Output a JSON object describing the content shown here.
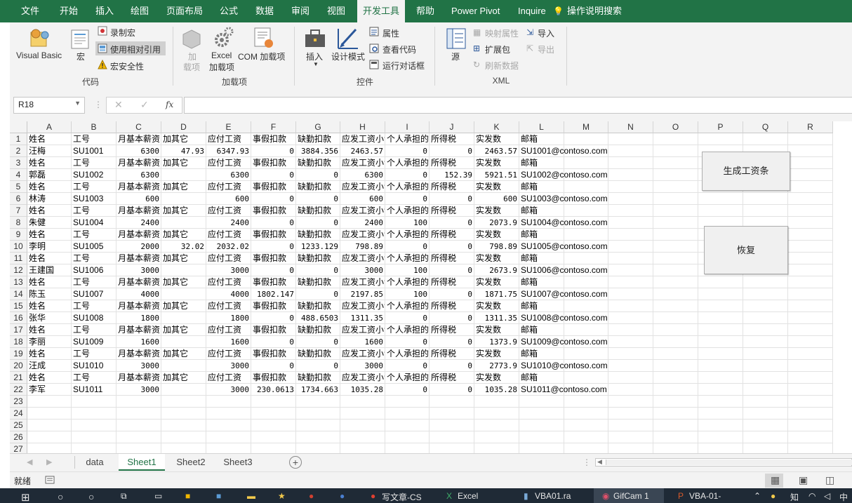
{
  "menu": {
    "tabs": [
      "文件",
      "开始",
      "插入",
      "绘图",
      "页面布局",
      "公式",
      "数据",
      "审阅",
      "视图",
      "开发工具",
      "帮助",
      "Power Pivot",
      "Inquire",
      "操作说明搜索"
    ],
    "active": "开发工具"
  },
  "ribbon": {
    "code": {
      "visual_basic": "Visual Basic",
      "macros": "宏",
      "record_macro": "录制宏",
      "relative_ref": "使用相对引用",
      "macro_security": "宏安全性",
      "group": "代码"
    },
    "addins": {
      "addins_line1": "加",
      "addins_line2": "载项",
      "excel_addins_line1": "Excel",
      "excel_addins_line2": "加载项",
      "com_addins": "COM 加载项",
      "group": "加载项"
    },
    "controls": {
      "insert": "插入",
      "design_mode": "设计模式",
      "properties": "属性",
      "view_code": "查看代码",
      "run_dialog": "运行对话框",
      "group": "控件"
    },
    "xml": {
      "source": "源",
      "map_props": "映射属性",
      "expansion": "扩展包",
      "refresh": "刷新数据",
      "import": "导入",
      "export": "导出",
      "group": "XML"
    }
  },
  "formula_bar": {
    "name_box": "R18",
    "fx": "fx",
    "formula": ""
  },
  "columns": [
    "A",
    "B",
    "C",
    "D",
    "E",
    "F",
    "G",
    "H",
    "I",
    "J",
    "K",
    "L",
    "M",
    "N",
    "O",
    "P",
    "Q",
    "R"
  ],
  "rows": [
    [
      "姓名",
      "工号",
      "月基本薪资",
      "加其它",
      "应付工资",
      "事假扣款",
      "缺勤扣款",
      "应发工资小计",
      "个人承担的",
      "所得税",
      "实发数",
      "邮箱"
    ],
    [
      "汪梅",
      "SU1001",
      "6300",
      "47.93",
      "6347.93",
      "0",
      "3884.356",
      "2463.57",
      "0",
      "0",
      "2463.57",
      "SU1001@contoso.com"
    ],
    [
      "姓名",
      "工号",
      "月基本薪资",
      "加其它",
      "应付工资",
      "事假扣款",
      "缺勤扣款",
      "应发工资小计",
      "个人承担的",
      "所得税",
      "实发数",
      "邮箱"
    ],
    [
      "郭磊",
      "SU1002",
      "6300",
      "",
      "6300",
      "0",
      "0",
      "6300",
      "0",
      "152.39",
      "5921.51",
      "SU1002@contoso.com"
    ],
    [
      "姓名",
      "工号",
      "月基本薪资",
      "加其它",
      "应付工资",
      "事假扣款",
      "缺勤扣款",
      "应发工资小计",
      "个人承担的",
      "所得税",
      "实发数",
      "邮箱"
    ],
    [
      "林涛",
      "SU1003",
      "600",
      "",
      "600",
      "0",
      "0",
      "600",
      "0",
      "0",
      "600",
      "SU1003@contoso.com"
    ],
    [
      "姓名",
      "工号",
      "月基本薪资",
      "加其它",
      "应付工资",
      "事假扣款",
      "缺勤扣款",
      "应发工资小计",
      "个人承担的",
      "所得税",
      "实发数",
      "邮箱"
    ],
    [
      "朱健",
      "SU1004",
      "2400",
      "",
      "2400",
      "0",
      "0",
      "2400",
      "100",
      "0",
      "2073.9",
      "SU1004@contoso.com"
    ],
    [
      "姓名",
      "工号",
      "月基本薪资",
      "加其它",
      "应付工资",
      "事假扣款",
      "缺勤扣款",
      "应发工资小计",
      "个人承担的",
      "所得税",
      "实发数",
      "邮箱"
    ],
    [
      "李明",
      "SU1005",
      "2000",
      "32.02",
      "2032.02",
      "0",
      "1233.129",
      "798.89",
      "0",
      "0",
      "798.89",
      "SU1005@contoso.com"
    ],
    [
      "姓名",
      "工号",
      "月基本薪资",
      "加其它",
      "应付工资",
      "事假扣款",
      "缺勤扣款",
      "应发工资小计",
      "个人承担的",
      "所得税",
      "实发数",
      "邮箱"
    ],
    [
      "王建国",
      "SU1006",
      "3000",
      "",
      "3000",
      "0",
      "0",
      "3000",
      "100",
      "0",
      "2673.9",
      "SU1006@contoso.com"
    ],
    [
      "姓名",
      "工号",
      "月基本薪资",
      "加其它",
      "应付工资",
      "事假扣款",
      "缺勤扣款",
      "应发工资小计",
      "个人承担的",
      "所得税",
      "实发数",
      "邮箱"
    ],
    [
      "陈玉",
      "SU1007",
      "4000",
      "",
      "4000",
      "1802.147",
      "0",
      "2197.85",
      "100",
      "0",
      "1871.75",
      "SU1007@contoso.com"
    ],
    [
      "姓名",
      "工号",
      "月基本薪资",
      "加其它",
      "应付工资",
      "事假扣款",
      "缺勤扣款",
      "应发工资小计",
      "个人承担的",
      "所得税",
      "实发数",
      "邮箱"
    ],
    [
      "张华",
      "SU1008",
      "1800",
      "",
      "1800",
      "0",
      "488.6503",
      "1311.35",
      "0",
      "0",
      "1311.35",
      "SU1008@contoso.com"
    ],
    [
      "姓名",
      "工号",
      "月基本薪资",
      "加其它",
      "应付工资",
      "事假扣款",
      "缺勤扣款",
      "应发工资小计",
      "个人承担的",
      "所得税",
      "实发数",
      "邮箱"
    ],
    [
      "李丽",
      "SU1009",
      "1600",
      "",
      "1600",
      "0",
      "0",
      "1600",
      "0",
      "0",
      "1373.9",
      "SU1009@contoso.com"
    ],
    [
      "姓名",
      "工号",
      "月基本薪资",
      "加其它",
      "应付工资",
      "事假扣款",
      "缺勤扣款",
      "应发工资小计",
      "个人承担的",
      "所得税",
      "实发数",
      "邮箱"
    ],
    [
      "汪成",
      "SU1010",
      "3000",
      "",
      "3000",
      "0",
      "0",
      "3000",
      "0",
      "0",
      "2773.9",
      "SU1010@contoso.com"
    ],
    [
      "姓名",
      "工号",
      "月基本薪资",
      "加其它",
      "应付工资",
      "事假扣款",
      "缺勤扣款",
      "应发工资小计",
      "个人承担的",
      "所得税",
      "实发数",
      "邮箱"
    ],
    [
      "李军",
      "SU1011",
      "3000",
      "",
      "3000",
      "230.0613",
      "1734.663",
      "1035.28",
      "0",
      "0",
      "1035.28",
      "SU1011@contoso.com"
    ]
  ],
  "row_numbers": [
    "1",
    "2",
    "3",
    "4",
    "5",
    "6",
    "7",
    "8",
    "9",
    "10",
    "11",
    "12",
    "13",
    "14",
    "15",
    "16",
    "17",
    "18",
    "19",
    "20",
    "21",
    "22",
    "23",
    "24",
    "25",
    "26",
    "27"
  ],
  "buttons": {
    "generate": "生成工资条",
    "restore": "恢复"
  },
  "sheet_tabs": {
    "tabs": [
      "data",
      "Sheet1",
      "Sheet2",
      "Sheet3"
    ],
    "active": "Sheet1"
  },
  "status": {
    "ready": "就绪"
  },
  "taskbar": {
    "items": [
      "写文章-CS",
      "Excel",
      "VBA01.ra",
      "GifCam 1",
      "VBA-01-"
    ],
    "tray": "知",
    "tray2": "中"
  }
}
